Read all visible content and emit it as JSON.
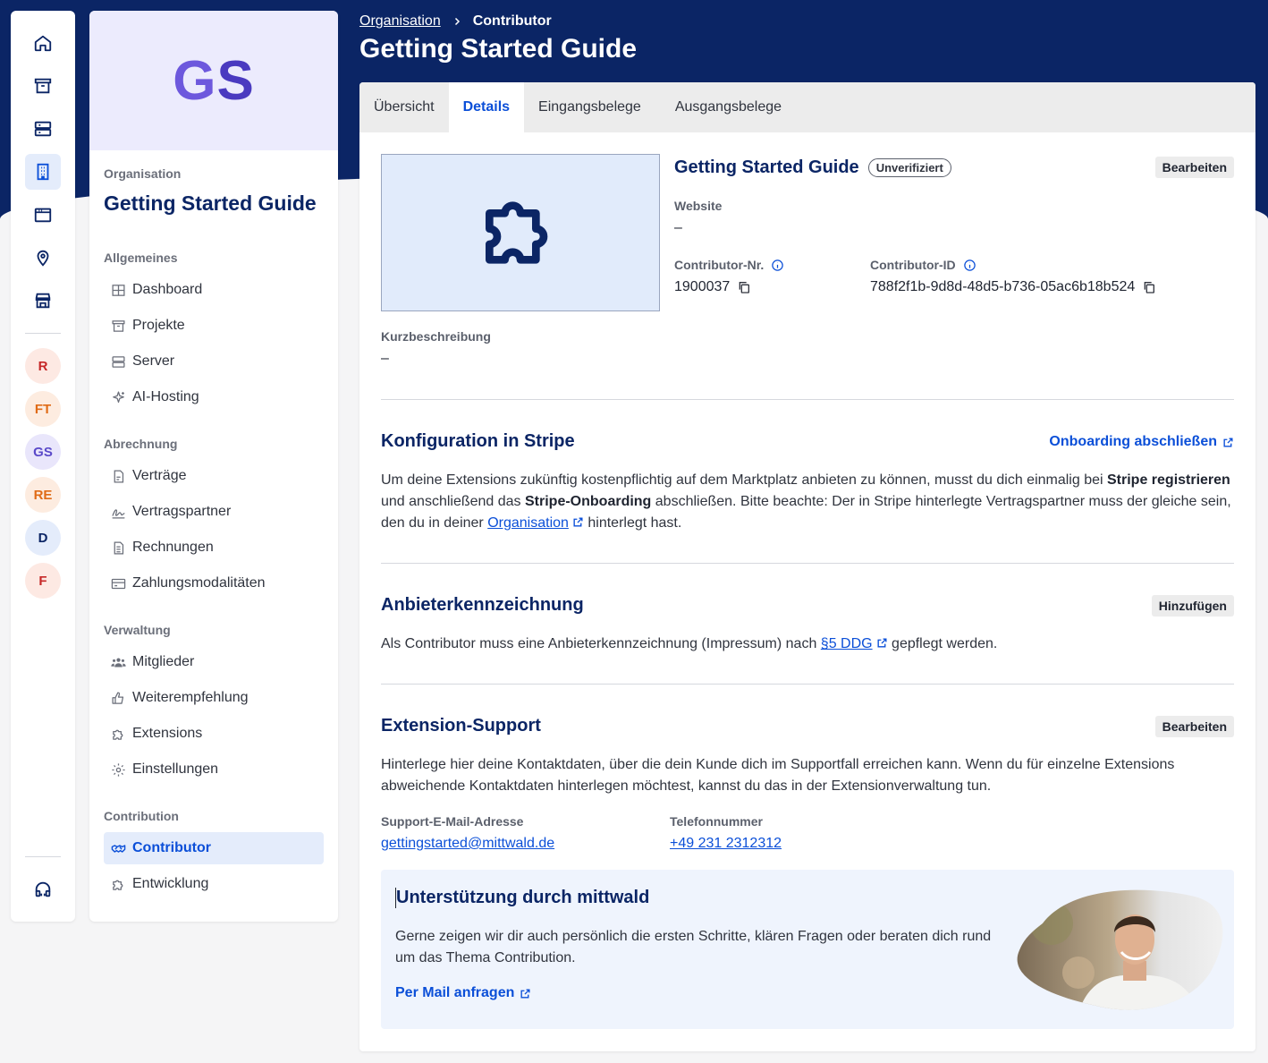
{
  "rail": {
    "icons": [
      "home-icon",
      "archive-icon",
      "server-icon",
      "building-icon",
      "browser-window-icon",
      "location-pin-icon",
      "store-icon"
    ],
    "orgs": [
      {
        "initials": "R",
        "bg": "#fde9e3",
        "fg": "#c62828"
      },
      {
        "initials": "FT",
        "bg": "#fdece0",
        "fg": "#e06b16"
      },
      {
        "initials": "GS",
        "bg": "#e9e6fb",
        "fg": "#5a49c9"
      },
      {
        "initials": "RE",
        "bg": "#fdece0",
        "fg": "#e06b16"
      },
      {
        "initials": "D",
        "bg": "#e4ecfb",
        "fg": "#0b2565"
      },
      {
        "initials": "F",
        "bg": "#fde9e3",
        "fg": "#c62828"
      }
    ],
    "support_icon": "headset-icon"
  },
  "org_panel": {
    "initials_g": "G",
    "initials_s": "S",
    "kicker": "Organisation",
    "title": "Getting Started Guide",
    "groups": {
      "allgemein": "Allgemeines",
      "abrechnung": "Abrechnung",
      "verwaltung": "Verwaltung",
      "contribution": "Contribution"
    },
    "items": {
      "dashboard": "Dashboard",
      "projekte": "Projekte",
      "server": "Server",
      "ai": "AI-Hosting",
      "vertraege": "Verträge",
      "vertragspartner": "Vertragspartner",
      "rechnungen": "Rechnungen",
      "zahlung": "Zahlungsmodalitäten",
      "mitglieder": "Mitglieder",
      "weiter": "Weiterempfehlung",
      "extensions": "Extensions",
      "einstellungen": "Einstellungen",
      "contributor": "Contributor",
      "entwicklung": "Entwicklung"
    }
  },
  "header": {
    "crumb_parent": "Organisation",
    "crumb_current": "Contributor",
    "title": "Getting Started Guide"
  },
  "tabs": [
    "Übersicht",
    "Details",
    "Eingangsbelege",
    "Ausgangsbelege"
  ],
  "details": {
    "name": "Getting Started Guide",
    "badge": "Unverifiziert",
    "edit": "Bearbeiten",
    "website_label": "Website",
    "website_value": "–",
    "nr_label": "Contributor-Nr.",
    "nr_value": "1900037",
    "id_label": "Contributor-ID",
    "id_value": "788f2f1b-9d8d-48d5-b736-05ac6b18b524",
    "kurz_label": "Kurzbeschreibung",
    "kurz_value": "–"
  },
  "stripe": {
    "title": "Konfiguration in Stripe",
    "action": "Onboarding abschließen",
    "t1": "Um deine Extensions zukünftig kostenpflichtig auf dem Marktplatz anbieten zu können, musst du dich einmalig bei ",
    "b1": "Stripe registrieren",
    "t2": " und anschließend das ",
    "b2": "Stripe-Onboarding",
    "t3": " abschließen. Bitte beachte: Der in Stripe hinterlegte Vertragspartner muss der gleiche sein, den du in deiner ",
    "link": "Organisation",
    "t4": " hinterlegt hast."
  },
  "impressum": {
    "title": "Anbieterkennzeichnung",
    "action": "Hinzufügen",
    "t1": "Als Contributor muss eine Anbieterkennzeichnung (Impressum) nach ",
    "link": "§5 DDG",
    "t2": " gepflegt werden."
  },
  "support": {
    "title": "Extension-Support",
    "action": "Bearbeiten",
    "text": "Hinterlege hier deine Kontaktdaten, über die dein Kunde dich im Supportfall erreichen kann. Wenn du für einzelne Extensions abweichende Kontaktdaten hinterlegen möchtest, kannst du das in der Extensionverwaltung tun.",
    "mail_label": "Support-E-Mail-Adresse",
    "mail_value": "gettingstarted@mittwald.de",
    "phone_label": "Telefonnummer",
    "phone_value": "+49 231 2312312"
  },
  "mittwald": {
    "title": "Unterstützung durch mittwald",
    "text": "Gerne zeigen wir dir auch persönlich die ersten Schritte, klären Fragen oder beraten dich rund um das Thema Contribution.",
    "action": "Per Mail anfragen"
  },
  "colors": {
    "brand_navy": "#0b2565",
    "accent_blue": "#0b4fd8"
  }
}
